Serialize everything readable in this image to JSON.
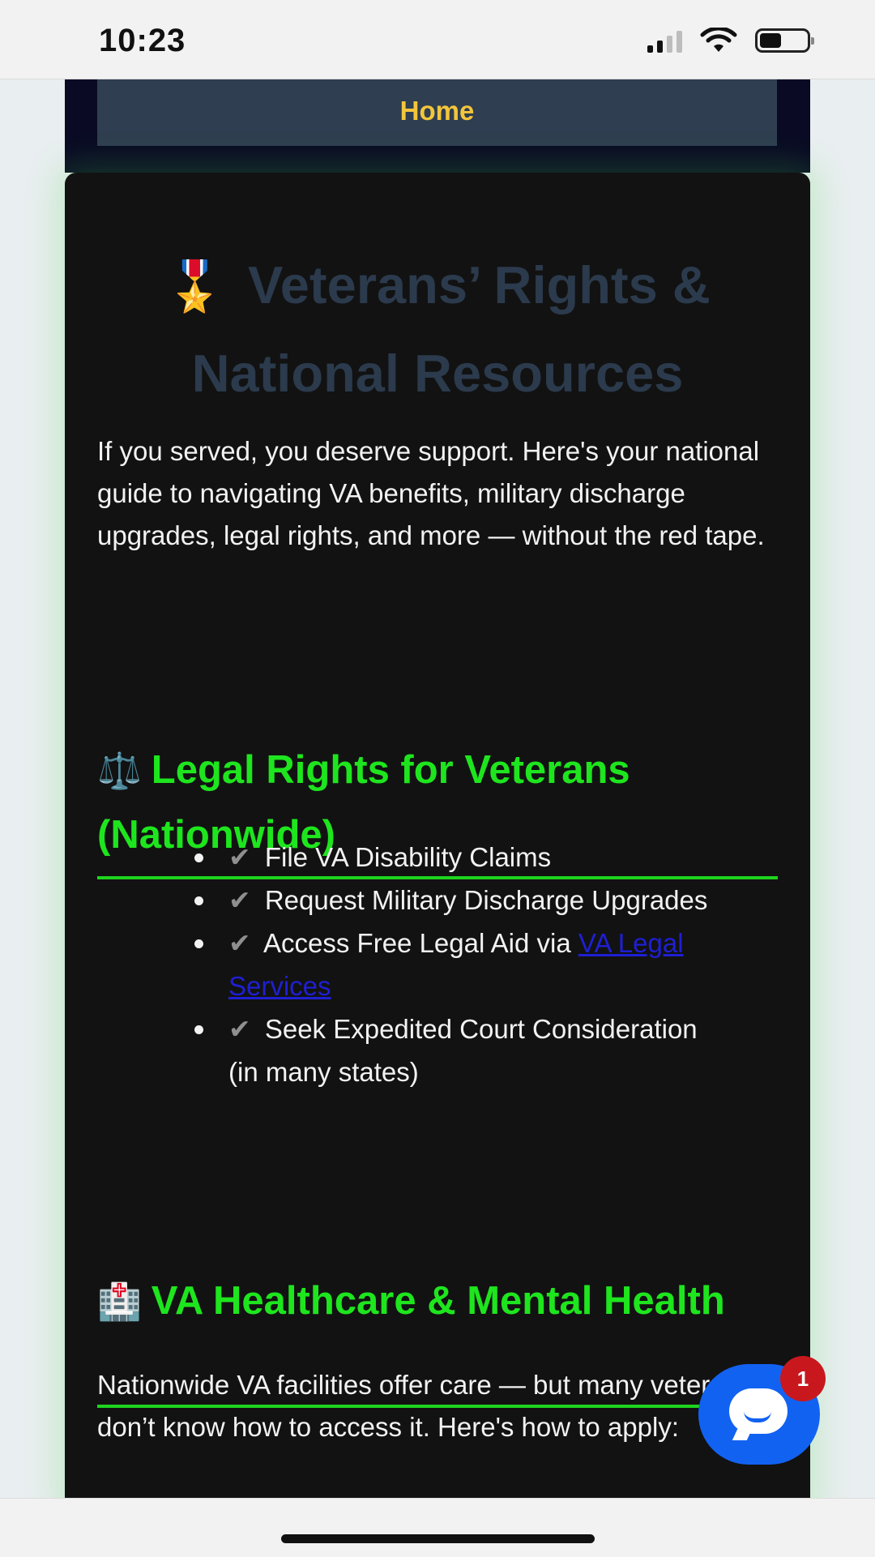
{
  "status_bar": {
    "time": "10:23"
  },
  "nav": {
    "home_label": "Home"
  },
  "hero": {
    "icon": "medal-icon",
    "medal_glyph": "🎖️",
    "title": "Veterans’ Rights & National Resources"
  },
  "intro_text": "If you served, you deserve support. Here's your national guide to navigating VA benefits, military discharge upgrades, legal rights, and more — without the red tape.",
  "legal_section": {
    "icon": "scales-icon",
    "glyph": "⚖️",
    "heading": "Legal Rights for Veterans (Nationwide)",
    "check_glyph": "✔",
    "items": [
      "File VA Disability Claims",
      "Request Military Discharge Upgrades",
      "Access Free Legal Aid via ",
      "Seek Expedited Court Consideration (in many states)"
    ],
    "link_text": "VA Legal Services"
  },
  "healthcare_section": {
    "icon": "hospital-icon",
    "glyph": "🏥",
    "heading": "VA Healthcare & Mental Health",
    "text": "Nationwide VA facilities offer care — but many veterans don’t know how to access it. Here's how to apply:"
  },
  "chat_widget": {
    "badge_count": "1",
    "icon": "chat-icon"
  },
  "colors": {
    "accent_green": "#1ee51e",
    "home_text": "#f3c53b",
    "card_bg": "#121212",
    "chat_blue": "#1262f2",
    "badge_red": "#c8181e",
    "link_blue": "#1f1fd4"
  }
}
